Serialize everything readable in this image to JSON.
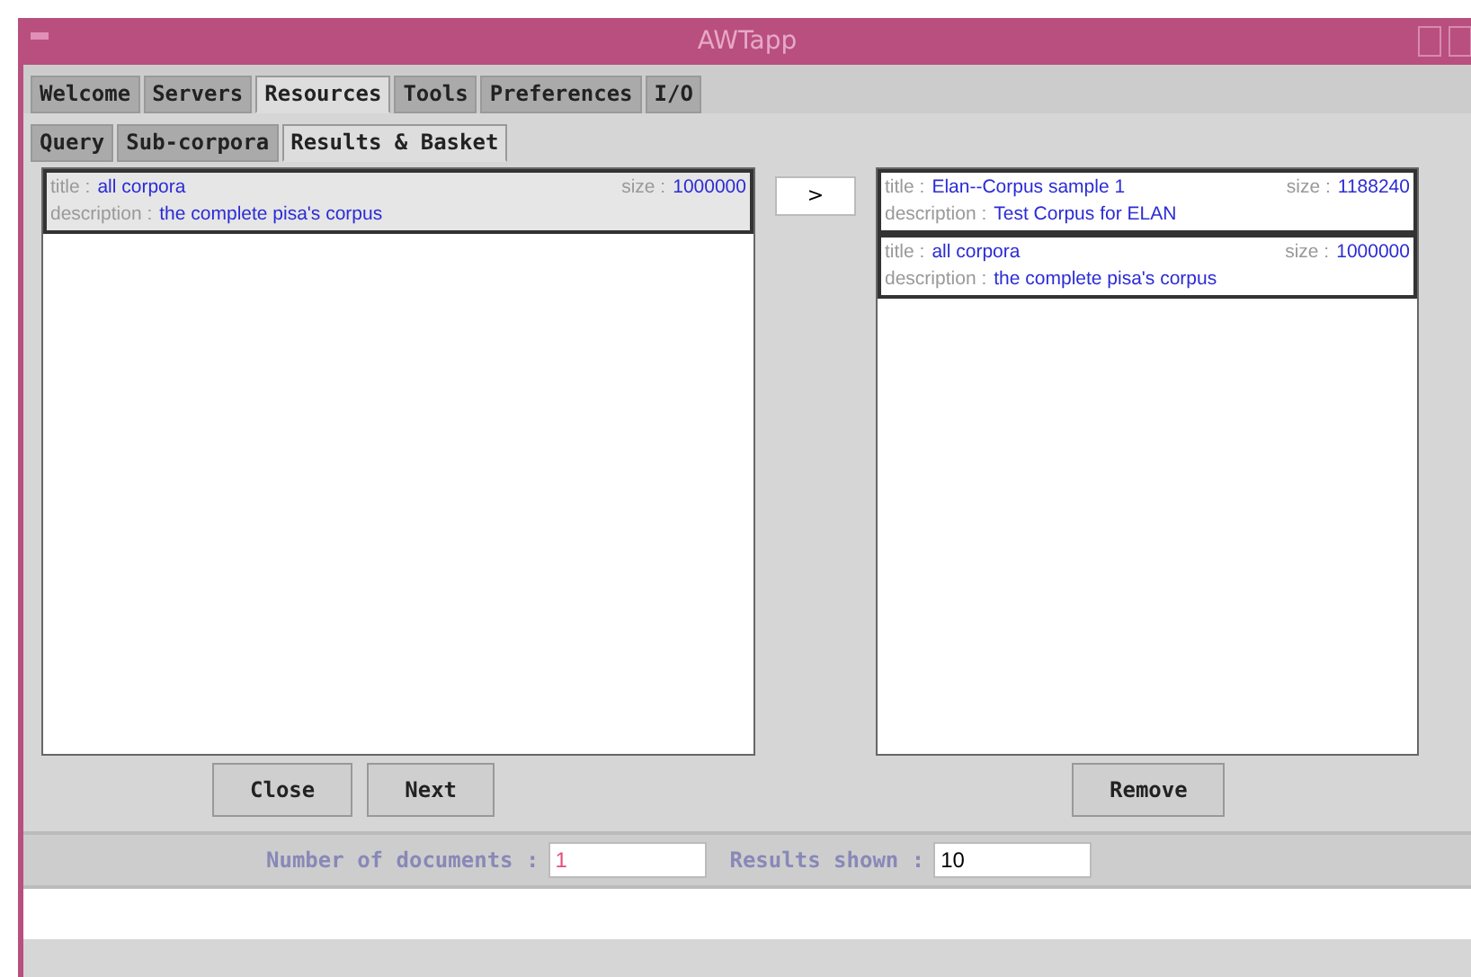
{
  "window": {
    "title": "AWTapp"
  },
  "tabs": [
    {
      "label": "Welcome",
      "selected": false
    },
    {
      "label": "Servers",
      "selected": false
    },
    {
      "label": "Resources",
      "selected": true
    },
    {
      "label": "Tools",
      "selected": false
    },
    {
      "label": "Preferences",
      "selected": false
    },
    {
      "label": "I/O",
      "selected": false
    }
  ],
  "subtabs": [
    {
      "label": "Query",
      "selected": false
    },
    {
      "label": "Sub-corpora",
      "selected": false
    },
    {
      "label": "Results & Basket",
      "selected": true
    }
  ],
  "results": [
    {
      "title_label": "title :",
      "title": "all corpora",
      "size_label": "size :",
      "size": "1000000",
      "description_label": "description :",
      "description": "the complete pisa's corpus",
      "selected": true
    }
  ],
  "move_button": ">",
  "basket": [
    {
      "title_label": "title :",
      "title": "Elan--Corpus sample 1",
      "size_label": "size :",
      "size": "1188240",
      "description_label": "description :",
      "description": "Test Corpus for ELAN",
      "selected": false
    },
    {
      "title_label": "title :",
      "title": "all corpora",
      "size_label": "size :",
      "size": "1000000",
      "description_label": "description :",
      "description": "the complete pisa's corpus",
      "selected": false
    }
  ],
  "left_buttons": [
    "Close",
    "Next"
  ],
  "right_buttons": [
    "Remove"
  ],
  "footer": {
    "documents_label": "Number of documents :",
    "documents": "1",
    "shown_label": "Results shown :",
    "shown": "10"
  }
}
